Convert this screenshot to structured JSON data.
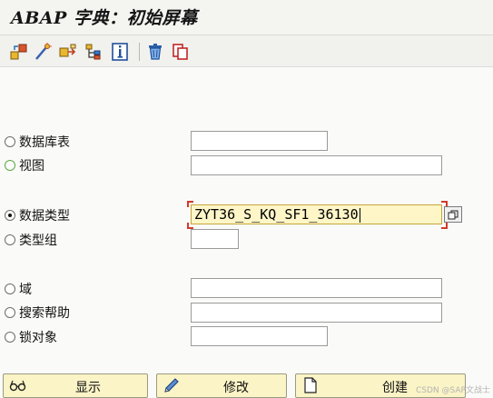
{
  "window": {
    "title": "ABAP 字典：初始屏幕"
  },
  "toolbar": {
    "icons": [
      "other-object-icon",
      "check-icon",
      "where-used-icon",
      "hierarchy-icon",
      "info-icon",
      "delete-icon",
      "copy-icon"
    ]
  },
  "options": [
    {
      "label": "数据库表",
      "selected": false
    },
    {
      "label": "视图",
      "selected": false
    },
    {
      "label": "数据类型",
      "selected": true
    },
    {
      "label": "类型组",
      "selected": false
    },
    {
      "label": "域",
      "selected": false
    },
    {
      "label": "搜索帮助",
      "selected": false
    },
    {
      "label": "锁对象",
      "selected": false
    }
  ],
  "fields": {
    "data_type_value": "ZYT36_S_KQ_SF1_36130"
  },
  "actions": {
    "display": "显示",
    "change": "修改",
    "create": "创建"
  },
  "watermark": "CSDN @SAP文战士",
  "colors": {
    "active_field": "#fff6c8",
    "button_bg": "#fbf4c6",
    "focus_corner": "#d23a2a"
  }
}
